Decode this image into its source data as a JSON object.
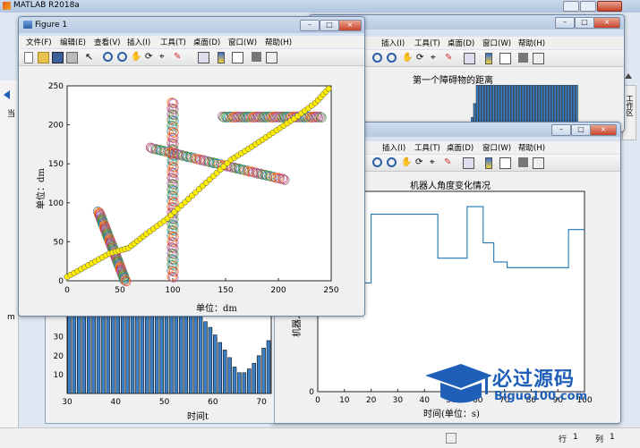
{
  "matlab": {
    "title": "MATLAB R2018a",
    "status_row_label": "行",
    "status_row": "1",
    "status_col_label": "列",
    "status_col": "1",
    "side_label": "工作区",
    "left_char": "当",
    "left_prefix": "m"
  },
  "menus": [
    "文件(F)",
    "编辑(E)",
    "查看(V)",
    "插入(I)",
    "工具(T)",
    "桌面(D)",
    "窗口(W)",
    "帮助(H)"
  ],
  "menus_partial": [
    "插入(I)",
    "工具(T)",
    "桌面(D)",
    "窗口(W)",
    "帮助(H)"
  ],
  "figure1": {
    "title": "Figure 1",
    "xlabel": "单位：dm",
    "ylabel": "单位：dm"
  },
  "figure_top_right": {
    "title": "第一个障碍物的距离"
  },
  "figure_hist": {
    "xlabel": "时间t"
  },
  "figure_angle": {
    "title": "机器人角度变化情况",
    "xlabel": "时间(单位：s)",
    "ylabel": "机器人"
  },
  "watermark": {
    "cn": "必过源码",
    "en": "Biguo100.com"
  },
  "colors": {
    "accent_blue": "#1f5fb8",
    "bar_fill": "#3a7fc6",
    "path_yellow": "#ffee00",
    "line_blue": "#1f77b4"
  },
  "chart_data": [
    {
      "type": "scatter",
      "xlim": [
        0,
        250
      ],
      "ylim": [
        0,
        250
      ],
      "xticks": [
        "0",
        "50",
        "100",
        "150",
        "200",
        "250"
      ],
      "yticks": [
        "0",
        "50",
        "100",
        "150",
        "200",
        "250"
      ],
      "series": [
        {
          "marker": "circle-filled",
          "color": "yellow",
          "points": [
            [
              0,
              5
            ],
            [
              20,
              20
            ],
            [
              40,
              35
            ],
            [
              58,
              42
            ],
            [
              75,
              60
            ],
            [
              95,
              80
            ],
            [
              115,
              105
            ],
            [
              135,
              130
            ],
            [
              155,
              155
            ],
            [
              175,
              172
            ],
            [
              195,
              190
            ],
            [
              215,
              208
            ],
            [
              235,
              228
            ],
            [
              250,
              250
            ]
          ]
        },
        {
          "marker": "circle-ring",
          "color": "multi",
          "segments": [
            [
              [
                30,
                88
              ],
              [
                55,
                0
              ]
            ],
            [
              [
                100,
                228
              ],
              [
                100,
                5
              ]
            ],
            [
              [
                80,
                170
              ],
              [
                205,
                130
              ]
            ],
            [
              [
                148,
                210
              ],
              [
                240,
                210
              ]
            ]
          ]
        }
      ]
    },
    {
      "type": "bar",
      "xlim": [
        30,
        72
      ],
      "ylim": [
        0,
        45
      ],
      "xticks": [
        "30",
        "40",
        "50",
        "60",
        "70"
      ],
      "yticks": [
        "10",
        "20",
        "30"
      ],
      "x": [
        30,
        31,
        32,
        33,
        34,
        35,
        36,
        37,
        38,
        39,
        40,
        41,
        42,
        43,
        44,
        45,
        46,
        47,
        48,
        49,
        50,
        51,
        52,
        53,
        54,
        55,
        56,
        57,
        58,
        59,
        60,
        61,
        62,
        63,
        64,
        65,
        66,
        67,
        68,
        69,
        70,
        71
      ],
      "values": [
        45,
        45,
        45,
        45,
        45,
        45,
        45,
        45,
        45,
        45,
        45,
        45,
        45,
        45,
        45,
        45,
        45,
        45,
        45,
        45,
        45,
        45,
        45,
        45,
        45,
        45,
        44,
        41,
        38,
        35,
        31,
        27,
        23,
        19,
        14,
        11,
        11,
        13,
        16,
        20,
        24,
        28
      ]
    },
    {
      "type": "line",
      "title": "机器人角度变化情况",
      "xlabel": "时间(单位：s)",
      "xlim": [
        0,
        100
      ],
      "ylim": [
        0,
        1.05
      ],
      "xticks": [
        "0",
        "10",
        "20",
        "30",
        "40",
        "50",
        "60",
        "70",
        "80",
        "90",
        "100"
      ],
      "yticks": [
        "0",
        "0.5"
      ],
      "x": [
        0,
        10,
        10,
        20,
        20,
        45,
        45,
        56,
        56,
        62,
        62,
        66,
        66,
        71,
        71,
        94,
        94,
        100
      ],
      "y": [
        0.62,
        0.62,
        0.57,
        0.57,
        0.93,
        0.93,
        0.7,
        0.7,
        0.97,
        0.97,
        0.78,
        0.78,
        0.68,
        0.68,
        0.65,
        0.65,
        0.85,
        0.85
      ]
    },
    {
      "type": "bar",
      "title": "第一个障碍物的距离",
      "values": [
        0.3,
        0.6,
        1,
        1,
        1,
        1,
        1,
        1,
        1,
        1,
        1,
        1,
        1,
        1,
        1,
        1,
        1,
        1,
        1,
        1,
        1,
        1,
        1,
        1,
        1,
        1,
        1,
        1,
        1,
        1,
        1,
        1,
        1,
        1,
        1,
        1,
        1,
        1,
        1,
        1
      ]
    }
  ]
}
